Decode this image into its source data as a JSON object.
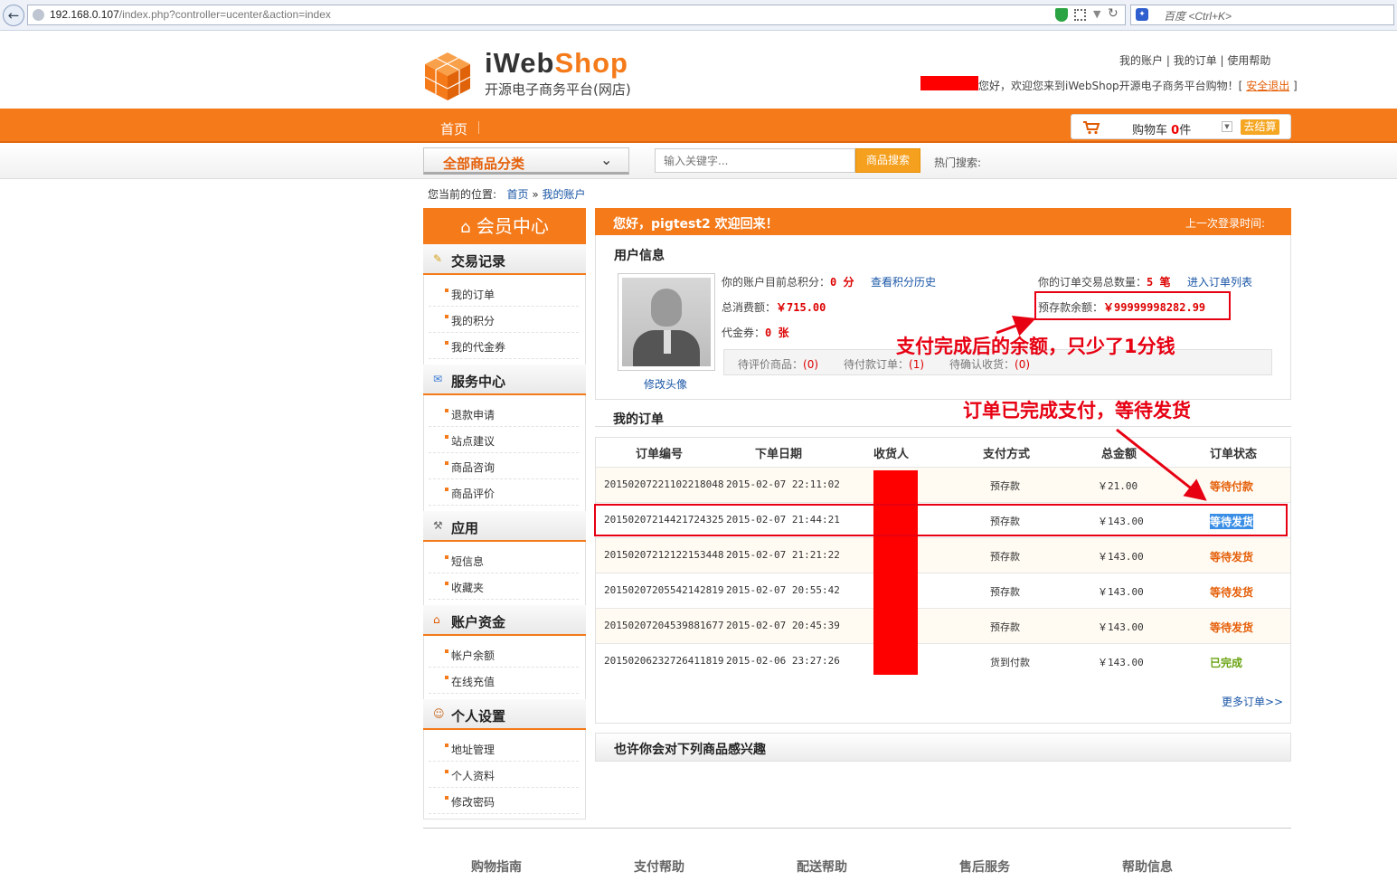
{
  "browser": {
    "url_host": "192.168.0.107",
    "url_path": "/index.php?controller=ucenter&action=index",
    "search_placeholder": "百度 <Ctrl+K>"
  },
  "header": {
    "logo_name_a": "iWeb",
    "logo_name_b": "Shop",
    "logo_sub": "开源电子商务平台(网店)",
    "links": [
      "我的账户",
      "我的订单",
      "使用帮助"
    ],
    "welcome": "您好，欢迎您来到iWebShop开源电子商务平台购物！[",
    "logout": "安全退出",
    "welcome_end": "]"
  },
  "nav": {
    "home": "首页",
    "cart_label": "购物车",
    "cart_count": "0",
    "cart_unit": "件",
    "checkout": "去结算"
  },
  "search": {
    "category": "全部商品分类",
    "placeholder": "输入关键字...",
    "button": "商品搜索",
    "hot": "热门搜索:"
  },
  "breadcrumb": {
    "label": "您当前的位置:",
    "home": "首页",
    "sep": "»",
    "current": "我的账户"
  },
  "sidebar": {
    "title": "会员中心",
    "groups": [
      {
        "title": "交易记录",
        "items": [
          "我的订单",
          "我的积分",
          "我的代金券"
        ]
      },
      {
        "title": "服务中心",
        "items": [
          "退款申请",
          "站点建议",
          "商品咨询",
          "商品评价"
        ]
      },
      {
        "title": "应用",
        "items": [
          "短信息",
          "收藏夹"
        ]
      },
      {
        "title": "账户资金",
        "items": [
          "帐户余额",
          "在线充值"
        ]
      },
      {
        "title": "个人设置",
        "items": [
          "地址管理",
          "个人资料",
          "修改密码"
        ]
      }
    ]
  },
  "welcome_bar": {
    "greeting": "您好，pigtest2 欢迎回来！",
    "last_login": "上一次登录时间:"
  },
  "user_info": {
    "title": "用户信息",
    "change_avatar": "修改头像",
    "points_label": "你的账户目前总积分：",
    "points_value": "0 分",
    "points_link": "查看积分历史",
    "spent_label": "总消费额：",
    "spent_value": "￥715.00",
    "voucher_label": "代金券：",
    "voucher_value": "0 张",
    "orders_label": "你的订单交易总数量：",
    "orders_value": "5 笔",
    "orders_link": "进入订单列表",
    "deposit_label": "预存款余额：",
    "deposit_value": "￥99999998282.99",
    "pending_review_label": "待评价商品：",
    "pending_review_value": "(0)",
    "pending_pay_label": "待付款订单：",
    "pending_pay_value": "(1)",
    "pending_confirm_label": "待确认收货：",
    "pending_confirm_value": "(0)"
  },
  "annotations": {
    "balance_note": "支付完成后的余额，只少了1分钱",
    "order_note": "订单已完成支付，等待发货"
  },
  "orders": {
    "title": "我的订单",
    "headers": [
      "订单编号",
      "下单日期",
      "收货人",
      "支付方式",
      "总金额",
      "订单状态"
    ],
    "rows": [
      {
        "id": "20150207221102218048",
        "date": "2015-02-07 22:11:02",
        "pay": "预存款",
        "amount": "￥21.00",
        "status": "等待付款",
        "color": "#e5600a"
      },
      {
        "id": "20150207214421724325",
        "date": "2015-02-07 21:44:21",
        "pay": "预存款",
        "amount": "￥143.00",
        "status": "等待发货",
        "color": "#e5600a"
      },
      {
        "id": "20150207212122153448",
        "date": "2015-02-07 21:21:22",
        "pay": "预存款",
        "amount": "￥143.00",
        "status": "等待发货",
        "color": "#e5600a"
      },
      {
        "id": "20150207205542142819",
        "date": "2015-02-07 20:55:42",
        "pay": "预存款",
        "amount": "￥143.00",
        "status": "等待发货",
        "color": "#e5600a"
      },
      {
        "id": "20150207204539881677",
        "date": "2015-02-07 20:45:39",
        "pay": "预存款",
        "amount": "￥143.00",
        "status": "等待发货",
        "color": "#e5600a"
      },
      {
        "id": "20150206232726411819",
        "date": "2015-02-06 23:27:26",
        "pay": "货到付款",
        "amount": "￥143.00",
        "status": "已完成",
        "color": "#6aa312"
      }
    ],
    "more": "更多订单>>"
  },
  "recommend": {
    "title": "也许你会对下列商品感兴趣"
  },
  "footer": {
    "links": [
      "购物指南",
      "支付帮助",
      "配送帮助",
      "售后服务",
      "帮助信息"
    ]
  }
}
